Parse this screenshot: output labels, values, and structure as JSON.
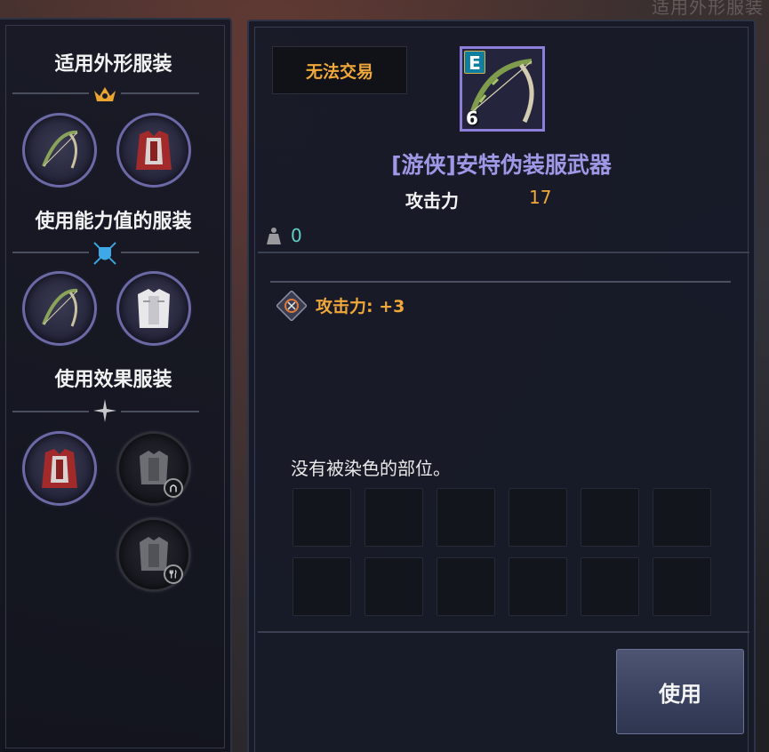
{
  "background_text": "适用外形服装",
  "left_panel": {
    "sections": [
      {
        "title": "适用外形服装",
        "ornament": "crown-ornament-icon"
      },
      {
        "title": "使用能力值的服装",
        "ornament": "shield-swords-ornament-icon"
      },
      {
        "title": "使用效果服装",
        "ornament": "star-ornament-icon"
      }
    ],
    "slots": [
      {
        "section": 0,
        "icon": "bow-icon",
        "filled": true
      },
      {
        "section": 0,
        "icon": "red-armor-icon",
        "filled": true
      },
      {
        "section": 1,
        "icon": "bow-icon",
        "filled": true
      },
      {
        "section": 1,
        "icon": "white-armor-icon",
        "filled": true
      },
      {
        "section": 2,
        "icon": "red-armor-icon",
        "filled": true
      },
      {
        "section": 2,
        "icon": "armor-placeholder-icon",
        "filled": false
      },
      {
        "section": 2,
        "icon": "armor-placeholder-icon",
        "filled": false
      }
    ]
  },
  "item": {
    "trade_status": "无法交易",
    "grade": "E",
    "count": "6",
    "name": "[游侠]安特伪装服武器",
    "stat_label": "攻击力",
    "stat_value": "17",
    "weight": "0",
    "effect": "攻击力: +3",
    "dye_message": "没有被染色的部位。",
    "dye_slots": 12
  },
  "actions": {
    "use_label": "使用"
  },
  "colors": {
    "accent_orange": "#f0a83a",
    "item_name_purple": "#9e98e6",
    "weight_teal": "#5fd1c4",
    "slot_border": "#6b6aa6"
  }
}
